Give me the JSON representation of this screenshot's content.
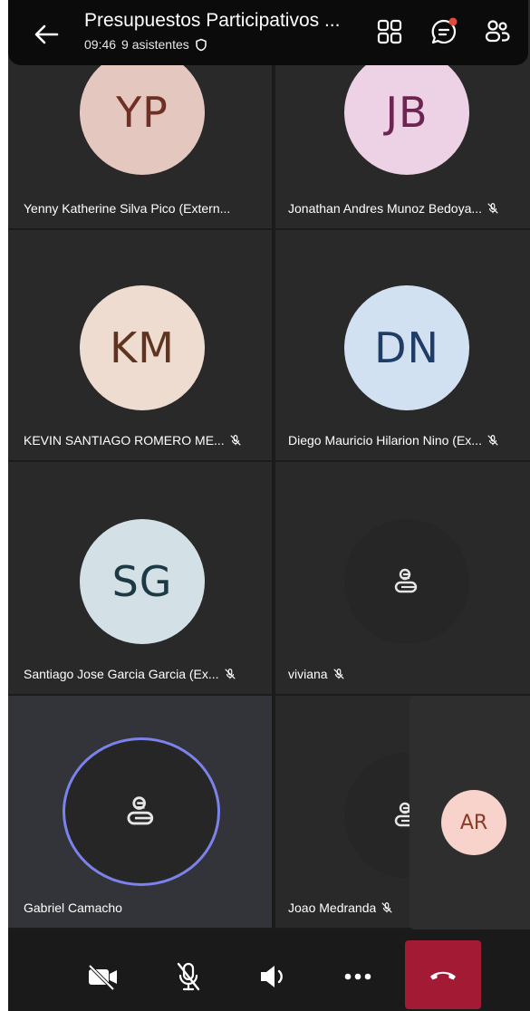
{
  "header": {
    "title": "Presupuestos Participativos ...",
    "time": "09:46",
    "attendees": "9 asistentes"
  },
  "participants": [
    {
      "initials": "YP",
      "name": "Yenny Katherine Silva Pico (Extern...",
      "muted": false,
      "avatar_bg": "#e4c7bf",
      "avatar_fg": "#6e2f24"
    },
    {
      "initials": "JB",
      "name": "Jonathan Andres Munoz Bedoya...",
      "muted": true,
      "avatar_bg": "#ecd2e4",
      "avatar_fg": "#6e2451"
    },
    {
      "initials": "KM",
      "name": "KEVIN SANTIAGO ROMERO ME...",
      "muted": true,
      "avatar_bg": "#efdcd0",
      "avatar_fg": "#5e3420"
    },
    {
      "initials": "DN",
      "name": "Diego Mauricio Hilarion Nino (Ex...",
      "muted": true,
      "avatar_bg": "#d2e1f2",
      "avatar_fg": "#1f3d66"
    },
    {
      "initials": "SG",
      "name": "Santiago Jose Garcia Garcia (Ex...",
      "muted": true,
      "avatar_bg": "#d3e1e6",
      "avatar_fg": "#1d3944"
    },
    {
      "initials": "",
      "name": "viviana",
      "muted": true,
      "avatar_bg": "#262626",
      "avatar_fg": "#ffffff"
    },
    {
      "initials": "",
      "name": "Gabriel Camacho",
      "muted": false,
      "speaking": true,
      "avatar_bg": "#262626",
      "avatar_fg": "#ffffff"
    },
    {
      "initials": "",
      "name": "Joao Medranda",
      "muted": true,
      "avatar_bg": "#262626",
      "avatar_fg": "#ffffff"
    }
  ],
  "self_view": {
    "initials": "AR",
    "avatar_bg": "#f7d3cb",
    "avatar_fg": "#8a3a26"
  },
  "colors": {
    "speaking_ring": "#7b83eb",
    "end_call": "#a31a34",
    "notification_dot": "#e04b3c"
  },
  "icons": {
    "back": "arrow-left-icon",
    "gallery": "grid-icon",
    "chat": "chat-icon",
    "people": "people-icon",
    "camera": "camera-off-icon",
    "mic": "mic-off-icon",
    "speaker": "speaker-icon",
    "more": "more-icon",
    "hangup": "hangup-icon"
  }
}
